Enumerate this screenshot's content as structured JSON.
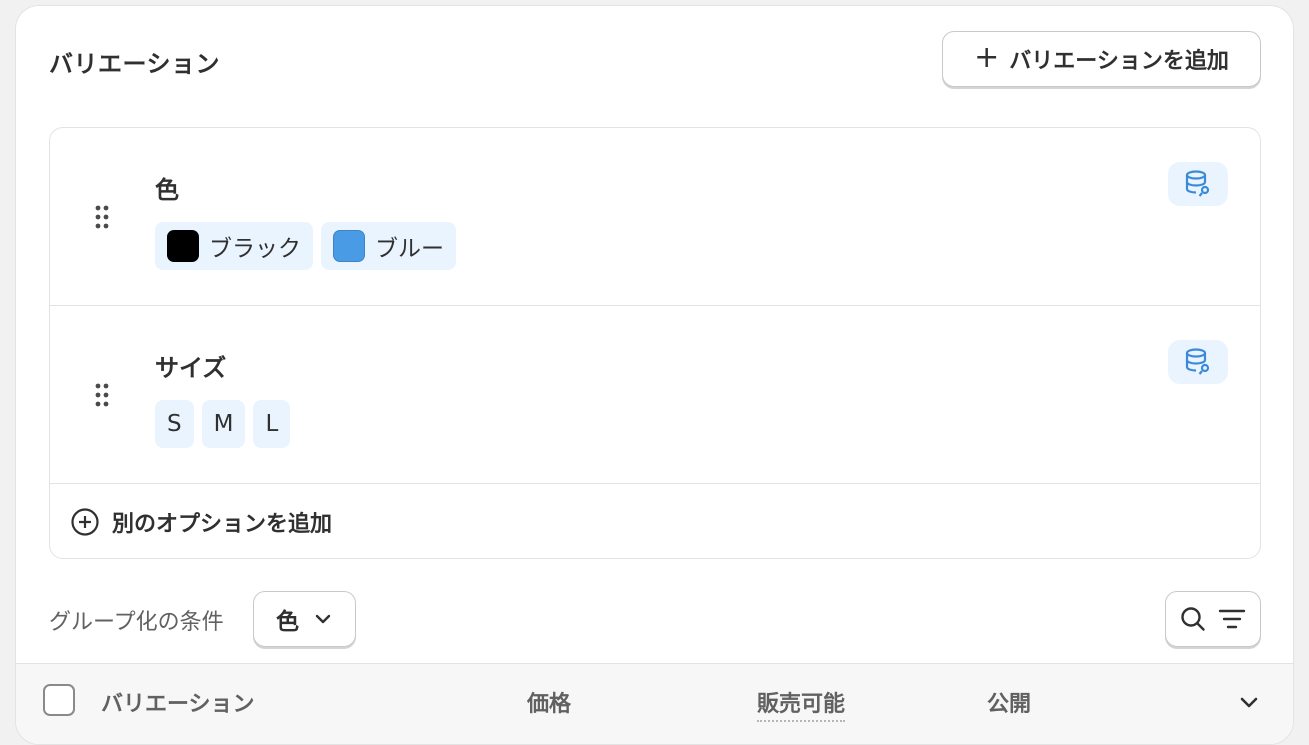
{
  "card": {
    "title": "バリエーション",
    "add_variant_label": "バリエーションを追加"
  },
  "options": [
    {
      "name": "色",
      "values": [
        {
          "label": "ブラック",
          "swatch": "#000000"
        },
        {
          "label": "ブルー",
          "swatch": "#4a9be6"
        }
      ]
    },
    {
      "name": "サイズ",
      "values": [
        {
          "label": "S"
        },
        {
          "label": "M"
        },
        {
          "label": "L"
        }
      ]
    }
  ],
  "add_option_label": "別のオプションを追加",
  "group_by": {
    "label": "グループ化の条件",
    "selected": "色"
  },
  "table": {
    "headers": {
      "variant": "バリエーション",
      "price": "価格",
      "available": "販売可能",
      "publish": "公開"
    }
  },
  "colors": {
    "accent_blue": "#4a9be6",
    "chip_bg": "#eaf4ff"
  }
}
